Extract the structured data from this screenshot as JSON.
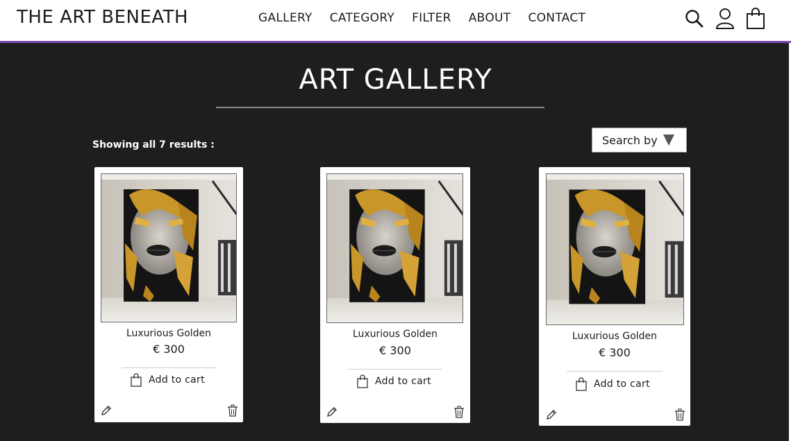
{
  "header": {
    "brand": "THE ART BENEATH",
    "nav": [
      "GALLERY",
      "CATEGORY",
      "FILTER",
      "ABOUT",
      "CONTACT"
    ],
    "icons": [
      "search-icon",
      "user-icon",
      "shopping-bag-icon"
    ]
  },
  "main": {
    "title": "ART GALLERY",
    "results_text": "Showing all 7 results :",
    "search_by_label": "Search by"
  },
  "products": [
    {
      "name": "Luxurious Golden",
      "price": "€ 300",
      "cart_label": "Add to cart"
    },
    {
      "name": "Luxurious Golden",
      "price": "€ 300",
      "cart_label": "Add to cart"
    },
    {
      "name": "Luxurious Golden",
      "price": "€ 300",
      "cart_label": "Add to cart"
    }
  ],
  "colors": {
    "background": "#1e1e1e",
    "header_border": "#7a4bb5",
    "gold": "#c9962a"
  }
}
